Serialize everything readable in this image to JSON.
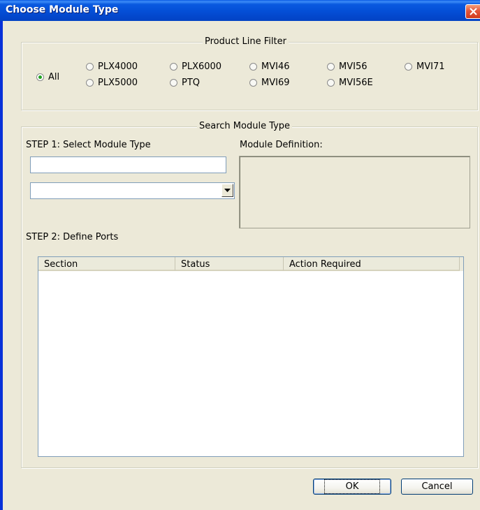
{
  "window": {
    "title": "Choose Module Type"
  },
  "filter": {
    "legend": "Product Line Filter",
    "options": [
      {
        "label": "All",
        "checked": true
      },
      {
        "label": "PLX4000",
        "checked": false
      },
      {
        "label": "PLX5000",
        "checked": false
      },
      {
        "label": "PLX6000",
        "checked": false
      },
      {
        "label": "PTQ",
        "checked": false
      },
      {
        "label": "MVI46",
        "checked": false
      },
      {
        "label": "MVI69",
        "checked": false
      },
      {
        "label": "MVI56",
        "checked": false
      },
      {
        "label": "MVI56E",
        "checked": false
      },
      {
        "label": "MVI71",
        "checked": false
      }
    ]
  },
  "search": {
    "legend": "Search Module Type",
    "step1_label": "STEP 1: Select Module Type",
    "module_type_value": "",
    "module_select_value": "",
    "definition_label": "Module Definition:",
    "step2_label": "STEP 2: Define Ports",
    "columns": [
      "Section",
      "Status",
      "Action Required"
    ],
    "rows": []
  },
  "buttons": {
    "ok": "OK",
    "cancel": "Cancel"
  },
  "colors": {
    "dialog_bg": "#ece9d8",
    "titlebar": "#0450d8",
    "close": "#e3553a"
  }
}
